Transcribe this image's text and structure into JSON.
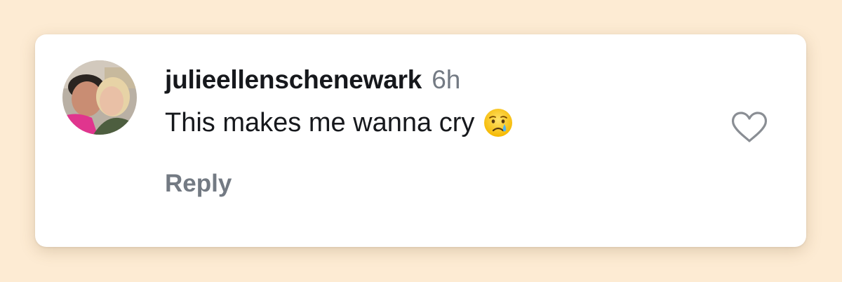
{
  "comment": {
    "username": "julieellenschenewark",
    "timestamp": "6h",
    "text": "This makes me wanna cry",
    "emoji": "crying-face-emoji",
    "reply_label": "Reply"
  },
  "icons": {
    "like": "heart-outline-icon"
  },
  "colors": {
    "background": "#fdebd3",
    "card": "#ffffff",
    "text_primary": "#16181c",
    "text_secondary": "#737a83",
    "heart_stroke": "#8a8e94"
  }
}
